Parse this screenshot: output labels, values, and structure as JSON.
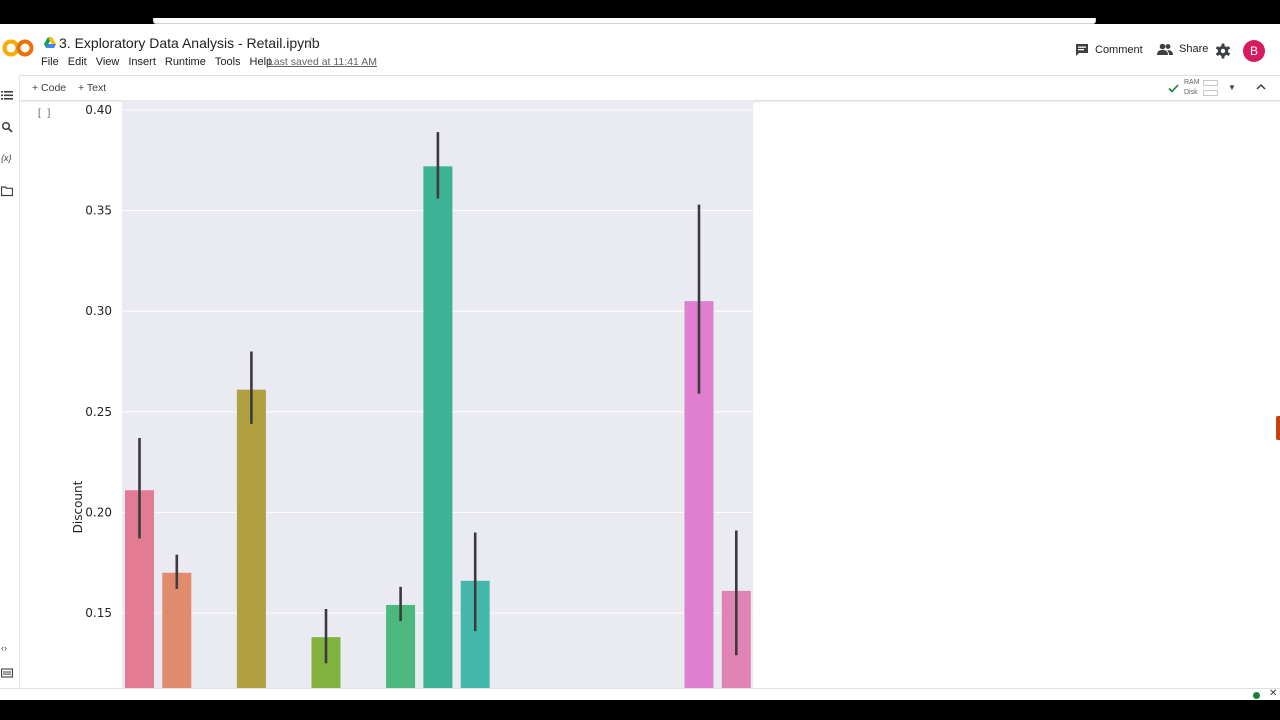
{
  "notebook": {
    "title": "3.  Exploratory Data Analysis - Retail.ipynb",
    "last_saved": "Last saved at 11:41 AM",
    "menu": [
      "File",
      "Edit",
      "View",
      "Insert",
      "Runtime",
      "Tools",
      "Help"
    ]
  },
  "header": {
    "comment_label": "Comment",
    "share_label": "Share",
    "avatar_letter": "B"
  },
  "toolbar": {
    "add_code_label": "+ Code",
    "add_text_label": "+ Text",
    "ram_label": "RAM",
    "disk_label": "Disk"
  },
  "cell": {
    "run_indicator": "[ ]"
  },
  "icons": {
    "logo": "colab-logo",
    "drive": "google-drive-icon",
    "star": "star-outline-icon",
    "comment": "comment-icon",
    "share": "people-icon",
    "settings": "gear-icon",
    "toc": "table-of-contents-icon",
    "search": "search-icon",
    "variables": "variables-icon",
    "files": "folder-icon",
    "code_snippets": "code-icon",
    "terminal": "terminal-icon",
    "connected": "check-icon",
    "collapse": "chevron-up-icon"
  },
  "chart_data": {
    "type": "bar",
    "ylabel": "Discount",
    "ylim": [
      0.12,
      0.4
    ],
    "yticks": [
      "0.15",
      "0.20",
      "0.25",
      "0.30",
      "0.35",
      "0.40"
    ],
    "grid": true,
    "bars": [
      {
        "slot": 0,
        "value": 0.211,
        "err_low": 0.187,
        "err_high": 0.237,
        "color": "#e37b94"
      },
      {
        "slot": 1,
        "value": 0.17,
        "err_low": 0.162,
        "err_high": 0.179,
        "color": "#e08c6c"
      },
      {
        "slot": 3,
        "value": 0.261,
        "err_low": 0.244,
        "err_high": 0.28,
        "color": "#b0a040"
      },
      {
        "slot": 5,
        "value": 0.138,
        "err_low": 0.125,
        "err_high": 0.152,
        "color": "#82b341"
      },
      {
        "slot": 7,
        "value": 0.154,
        "err_low": 0.146,
        "err_high": 0.163,
        "color": "#4db87d"
      },
      {
        "slot": 8,
        "value": 0.372,
        "err_low": 0.356,
        "err_high": 0.389,
        "color": "#3db395"
      },
      {
        "slot": 9,
        "value": 0.166,
        "err_low": 0.141,
        "err_high": 0.19,
        "color": "#44b8ab"
      },
      {
        "slot": 15,
        "value": 0.305,
        "err_low": 0.259,
        "err_high": 0.353,
        "color": "#e07ed0"
      },
      {
        "slot": 16,
        "value": 0.161,
        "err_low": 0.129,
        "err_high": 0.191,
        "color": "#e083b5"
      }
    ]
  }
}
